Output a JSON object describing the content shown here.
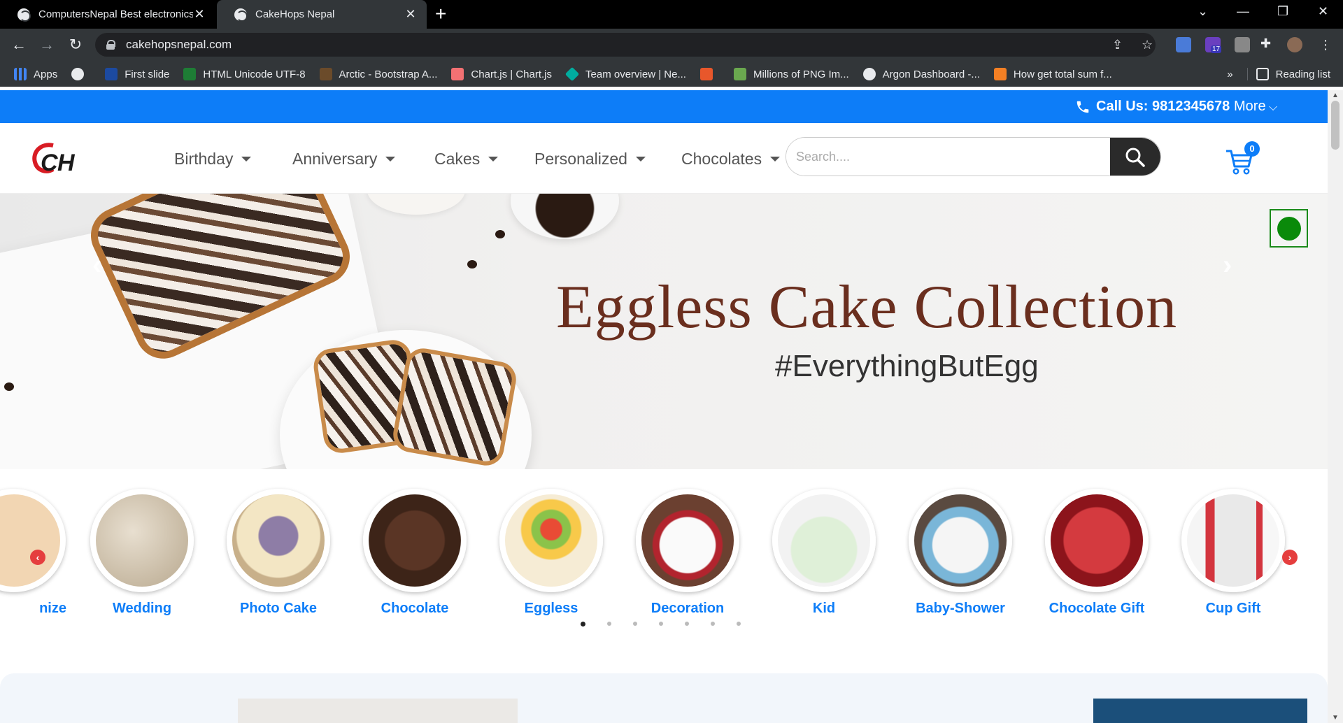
{
  "browser": {
    "tabs": [
      {
        "title": "ComputersNepal Best electronics",
        "active": false
      },
      {
        "title": "CakeHops Nepal",
        "active": true
      }
    ],
    "url": "cakehopsnepal.com",
    "ext_badge": "17",
    "bookmarks": [
      {
        "label": "Apps",
        "icon": "apps-grid-icon"
      },
      {
        "label": "",
        "icon": "globe-icon"
      },
      {
        "label": "First slide",
        "icon": "wa-icon"
      },
      {
        "label": "HTML Unicode UTF-8",
        "icon": "w-icon"
      },
      {
        "label": "Arctic - Bootstrap A...",
        "icon": "arctic-icon"
      },
      {
        "label": "Chart.js | Chart.js",
        "icon": "chartjs-icon"
      },
      {
        "label": "Team overview | Ne...",
        "icon": "diamond-icon"
      },
      {
        "label": "",
        "icon": "pdf-icon"
      },
      {
        "label": "Millions of PNG Im...",
        "icon": "png-icon"
      },
      {
        "label": "Argon Dashboard -...",
        "icon": "argon-icon"
      },
      {
        "label": "How get total sum f...",
        "icon": "stack-icon"
      }
    ],
    "bookmarks_overflow": "»",
    "reading_list": "Reading list"
  },
  "site": {
    "call_label": "Call Us: 9812345678",
    "more_label": "More",
    "menu": [
      "Birthday",
      "Anniversary",
      "Cakes",
      "Personalized",
      "Chocolates"
    ],
    "search_placeholder": "Search....",
    "cart_count": "0",
    "hero": {
      "title": "Eggless Cake Collection",
      "subtitle": "#EverythingButEgg",
      "prev": "‹",
      "next": "›"
    },
    "categories": [
      {
        "label": "nize",
        "color": "#f2d6b3"
      },
      {
        "label": "Wedding",
        "color": "#c9bfae"
      },
      {
        "label": "Photo Cake",
        "color": "#d9c7a8"
      },
      {
        "label": "Chocolate",
        "color": "#3d2418"
      },
      {
        "label": "Eggless",
        "color": "#f3e6c4"
      },
      {
        "label": "Decoration",
        "color": "#e9dfd7"
      },
      {
        "label": "Kid",
        "color": "#dfeee0"
      },
      {
        "label": "Baby-Shower",
        "color": "#7ab6d8"
      },
      {
        "label": "Chocolate Gift",
        "color": "#b3222b"
      },
      {
        "label": "Cup Gift",
        "color": "#d3353e"
      }
    ],
    "carousel_pages": 7,
    "carousel_active": 0,
    "accent": "#0d7df8"
  }
}
